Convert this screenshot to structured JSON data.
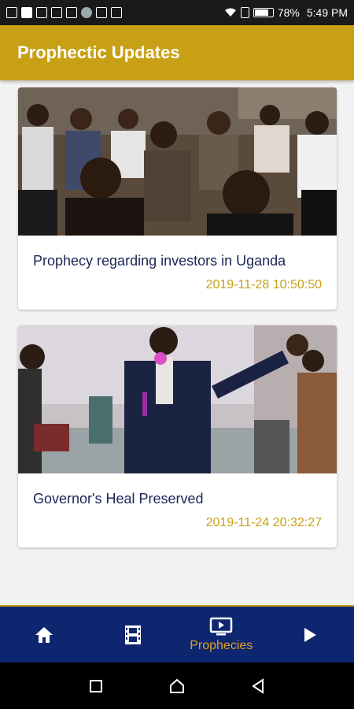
{
  "status_bar": {
    "battery": "78%",
    "time": "5:49 PM"
  },
  "app_bar": {
    "title": "Prophectic Updates"
  },
  "posts": [
    {
      "title": "Prophecy regarding investors in Uganda",
      "date": "2019-11-28 10:50:50",
      "image": "audience-seated-photo"
    },
    {
      "title": "Governor's Heal Preserved",
      "date": "2019-11-24 20:32:27",
      "image": "preacher-with-microphone-photo"
    }
  ],
  "bottom_nav": {
    "items": [
      {
        "icon": "home-icon",
        "label": ""
      },
      {
        "icon": "film-icon",
        "label": ""
      },
      {
        "icon": "tv-play-icon",
        "label": "Prophecies",
        "active": true
      },
      {
        "icon": "play-icon",
        "label": ""
      }
    ]
  },
  "colors": {
    "accent_gold": "#c8a015",
    "nav_blue": "#0e2670",
    "title_navy": "#1a2558"
  }
}
